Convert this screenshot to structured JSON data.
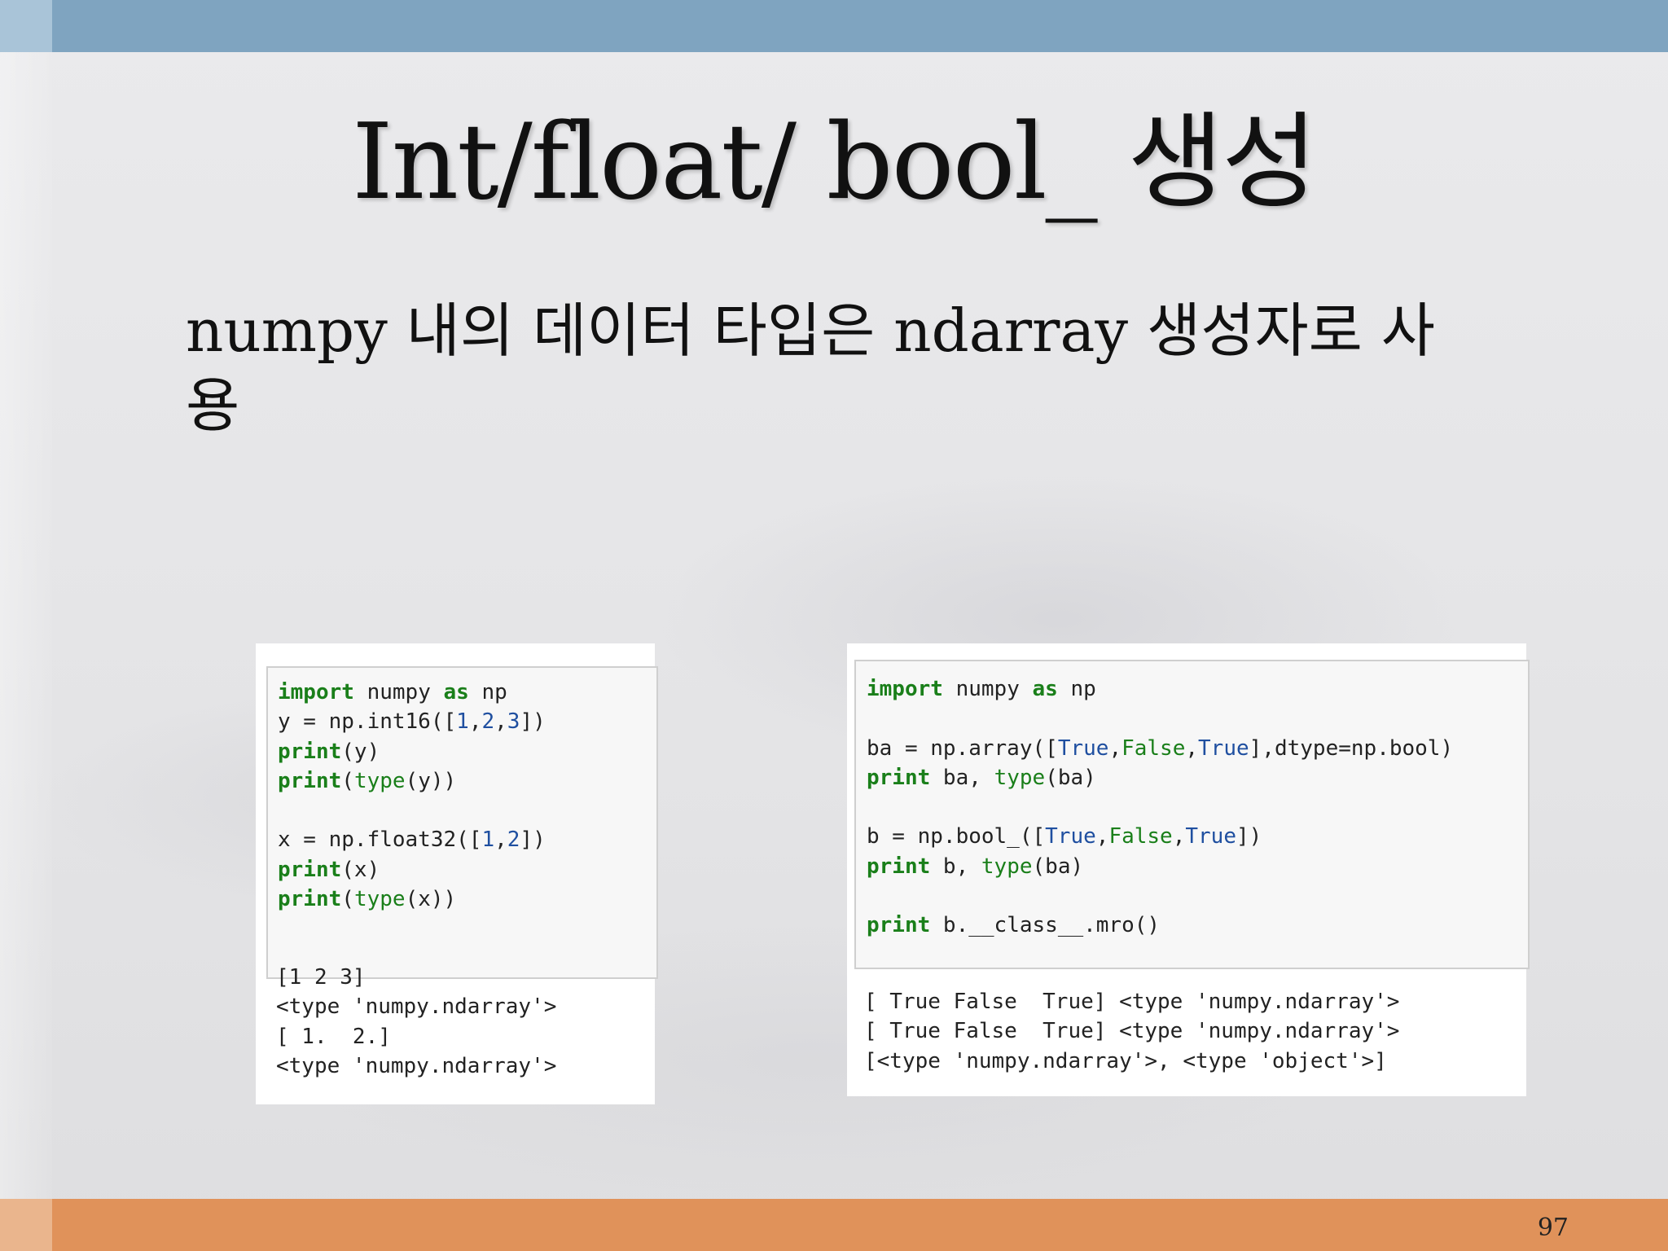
{
  "slide": {
    "title": "Int/float/ bool_ 생성",
    "bullet_line1": "numpy 내의 데이터 타입은 ndarray 생성자로 사",
    "bullet_line2": "용",
    "page_number": "97"
  },
  "colors": {
    "top_bar": "#7fa4c0",
    "bottom_bar": "#e0925a",
    "keyword_green": "#1a7f1a",
    "number_blue": "#1f4fa0"
  },
  "left_example": {
    "code": [
      [
        {
          "t": "import",
          "c": "kw"
        },
        {
          "t": " numpy "
        },
        {
          "t": "as",
          "c": "kw"
        },
        {
          "t": " np"
        }
      ],
      [
        {
          "t": "y = np.int16(["
        },
        {
          "t": "1",
          "c": "num"
        },
        {
          "t": ","
        },
        {
          "t": "2",
          "c": "num"
        },
        {
          "t": ","
        },
        {
          "t": "3",
          "c": "num"
        },
        {
          "t": "])"
        }
      ],
      [
        {
          "t": "print",
          "c": "kw"
        },
        {
          "t": "(y)"
        }
      ],
      [
        {
          "t": "print",
          "c": "kw"
        },
        {
          "t": "("
        },
        {
          "t": "type",
          "c": "bi"
        },
        {
          "t": "(y))"
        }
      ],
      [
        {
          "t": ""
        }
      ],
      [
        {
          "t": "x = np.float32(["
        },
        {
          "t": "1",
          "c": "num"
        },
        {
          "t": ","
        },
        {
          "t": "2",
          "c": "num"
        },
        {
          "t": "])"
        }
      ],
      [
        {
          "t": "print",
          "c": "kw"
        },
        {
          "t": "(x)"
        }
      ],
      [
        {
          "t": "print",
          "c": "kw"
        },
        {
          "t": "("
        },
        {
          "t": "type",
          "c": "bi"
        },
        {
          "t": "(x))"
        }
      ]
    ],
    "output": [
      "[1 2 3]",
      "<type 'numpy.ndarray'>",
      "[ 1.  2.]",
      "<type 'numpy.ndarray'>"
    ]
  },
  "right_example": {
    "code": [
      [
        {
          "t": "import",
          "c": "kw"
        },
        {
          "t": " numpy "
        },
        {
          "t": "as",
          "c": "kw"
        },
        {
          "t": " np"
        }
      ],
      [
        {
          "t": ""
        }
      ],
      [
        {
          "t": "ba = np.array(["
        },
        {
          "t": "True",
          "c": "num"
        },
        {
          "t": ","
        },
        {
          "t": "False",
          "c": "bi"
        },
        {
          "t": ","
        },
        {
          "t": "True",
          "c": "num"
        },
        {
          "t": "],dtype=np.bool)"
        }
      ],
      [
        {
          "t": "print",
          "c": "kw"
        },
        {
          "t": " ba, "
        },
        {
          "t": "type",
          "c": "bi"
        },
        {
          "t": "(ba)"
        }
      ],
      [
        {
          "t": ""
        }
      ],
      [
        {
          "t": "b = np.bool_(["
        },
        {
          "t": "True",
          "c": "num"
        },
        {
          "t": ","
        },
        {
          "t": "False",
          "c": "bi"
        },
        {
          "t": ","
        },
        {
          "t": "True",
          "c": "num"
        },
        {
          "t": "])"
        }
      ],
      [
        {
          "t": "print",
          "c": "kw"
        },
        {
          "t": " b, "
        },
        {
          "t": "type",
          "c": "bi"
        },
        {
          "t": "(ba)"
        }
      ],
      [
        {
          "t": ""
        }
      ],
      [
        {
          "t": "print",
          "c": "kw"
        },
        {
          "t": " b.__class__.mro()"
        }
      ]
    ],
    "output": [
      "[ True False  True] <type 'numpy.ndarray'>",
      "[ True False  True] <type 'numpy.ndarray'>",
      "[<type 'numpy.ndarray'>, <type 'object'>]"
    ]
  }
}
